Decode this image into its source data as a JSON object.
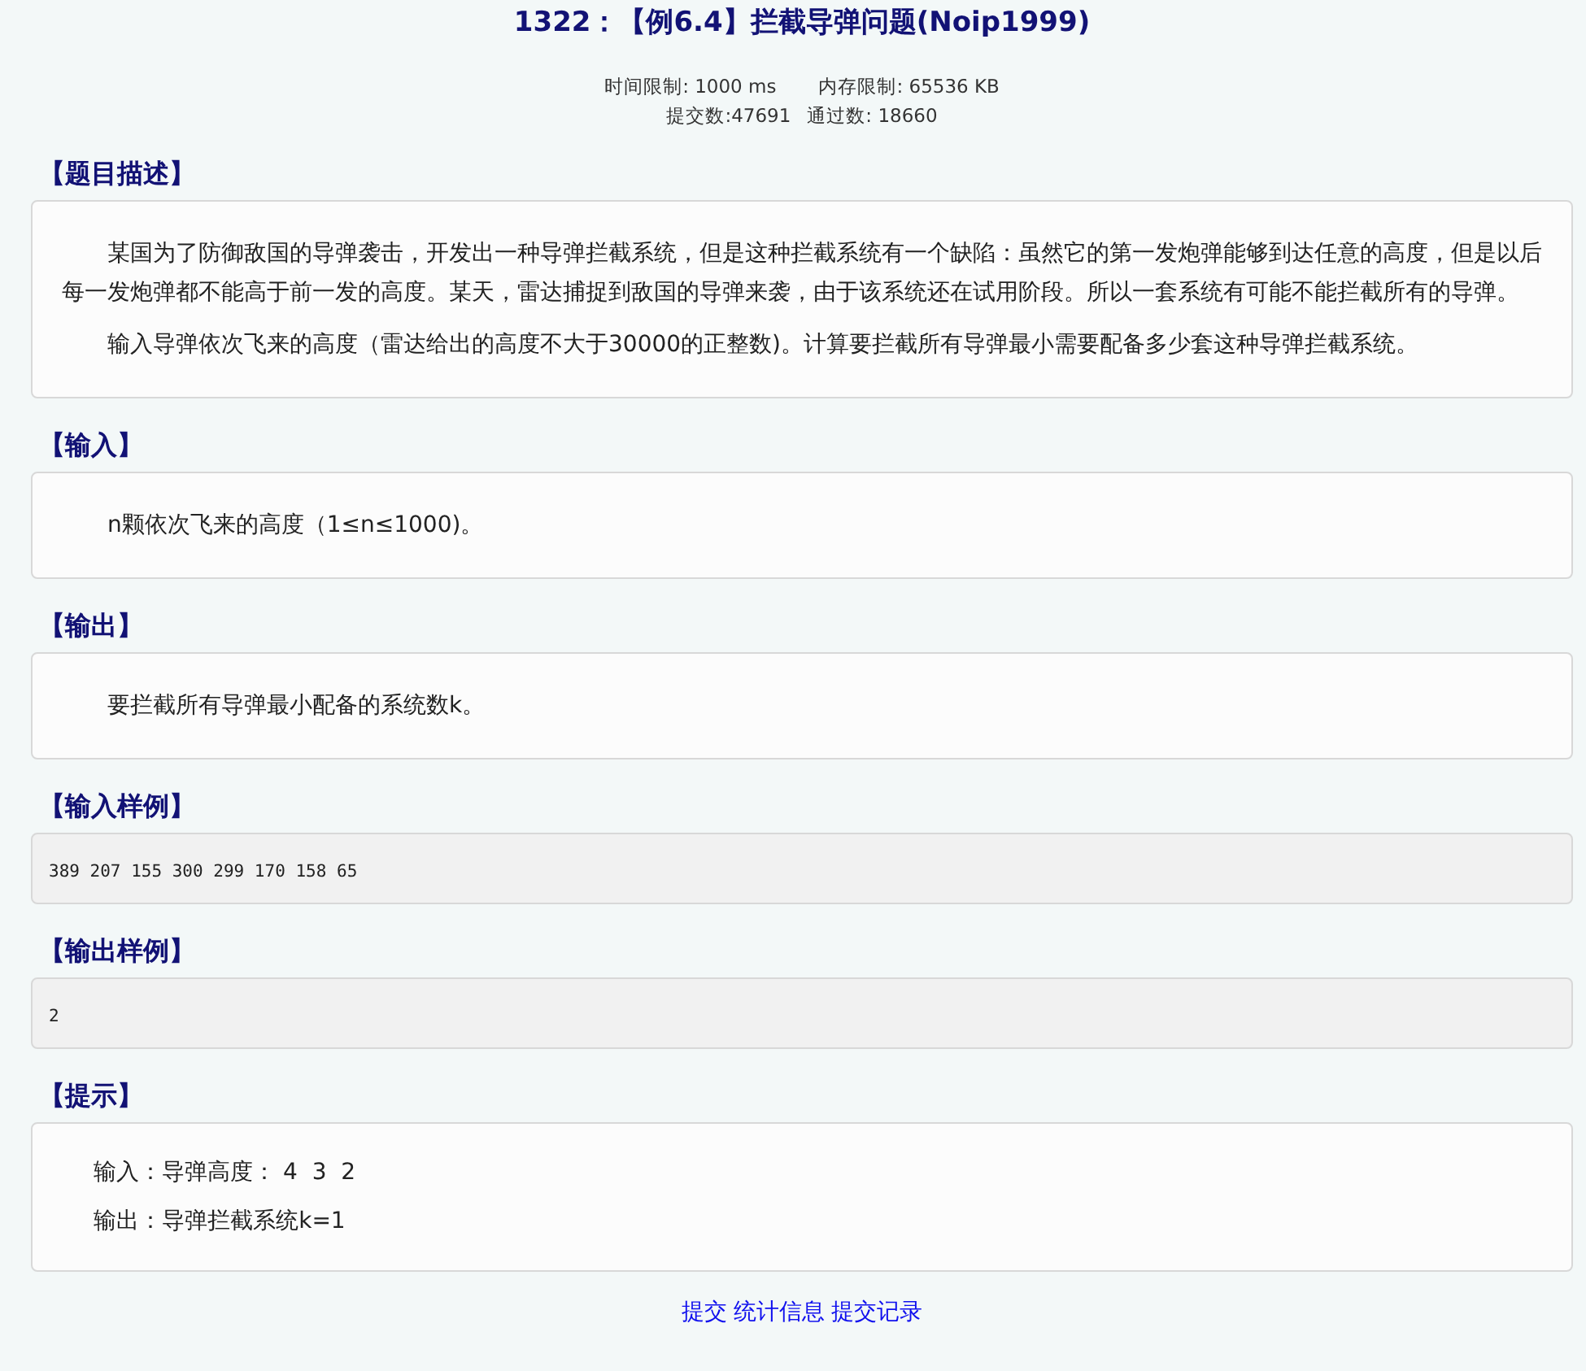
{
  "title": "1322：【例6.4】拦截导弹问题(Noip1999)",
  "meta_lines": [
    [
      "时间限制: 1000 ms",
      "内存限制: 65536 KB"
    ],
    [
      "提交数:47691",
      "通过数: 18660"
    ]
  ],
  "sections": [
    {
      "heading": "【题目描述】",
      "kind": "text",
      "paragraphs": [
        "某国为了防御敌国的导弹袭击，开发出一种导弹拦截系统，但是这种拦截系统有一个缺陷：虽然它的第一发炮弹能够到达任意的高度，但是以后每一发炮弹都不能高于前一发的高度。某天，雷达捕捉到敌国的导弹来袭，由于该系统还在试用阶段。所以一套系统有可能不能拦截所有的导弹。",
        "输入导弹依次飞来的高度（雷达给出的高度不大于30000的正整数)。计算要拦截所有导弹最小需要配备多少套这种导弹拦截系统。"
      ]
    },
    {
      "heading": "【输入】",
      "kind": "text",
      "paragraphs": [
        "n颗依次飞来的高度（1≤n≤1000)。"
      ]
    },
    {
      "heading": "【输出】",
      "kind": "text",
      "paragraphs": [
        "要拦截所有导弹最小配备的系统数k。"
      ]
    },
    {
      "heading": "【输入样例】",
      "kind": "code",
      "text": "389 207 155 300 299 170 158 65"
    },
    {
      "heading": "【输出样例】",
      "kind": "code",
      "text": "2"
    },
    {
      "heading": "【提示】",
      "kind": "hint",
      "paragraphs": [
        "输入：导弹高度： 4  3  2",
        "输出：导弹拦截系统k=1"
      ]
    }
  ],
  "footer_links": [
    "提交",
    "统计信息",
    "提交记录"
  ]
}
